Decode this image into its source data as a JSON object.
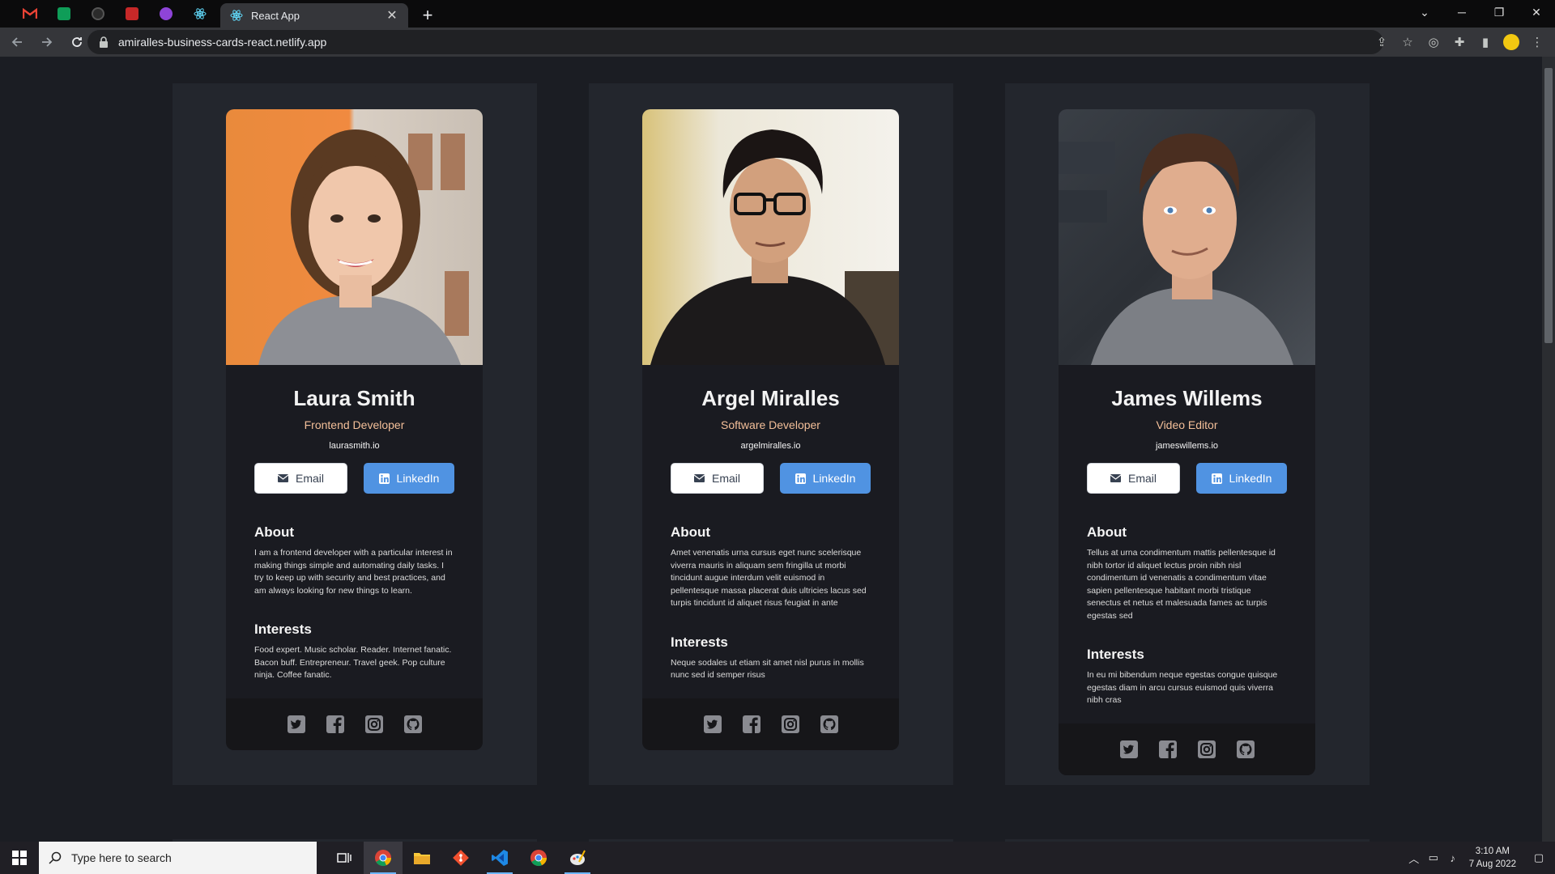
{
  "browser": {
    "active_tab_title": "React App",
    "tab_close": "✕",
    "new_tab": "+",
    "url": "amiralles-business-cards-react.netlify.app",
    "window_controls": {
      "menu": "⌄",
      "minimize": "─",
      "restore": "❐",
      "close": "✕"
    }
  },
  "cards": [
    {
      "name": "Laura Smith",
      "role": "Frontend Developer",
      "website": "laurasmith.io",
      "email_label": "Email",
      "linkedin_label": "LinkedIn",
      "about_title": "About",
      "about_text": "I am a frontend developer with a particular interest in making things simple and automating daily tasks. I try to keep up with security and best practices, and am always looking for new things to learn.",
      "interests_title": "Interests",
      "interests_text": "Food expert. Music scholar. Reader. Internet fanatic. Bacon buff. Entrepreneur. Travel geek. Pop culture ninja. Coffee fanatic."
    },
    {
      "name": "Argel Miralles",
      "role": "Software Developer",
      "website": "argelmiralles.io",
      "email_label": "Email",
      "linkedin_label": "LinkedIn",
      "about_title": "About",
      "about_text": "Amet venenatis urna cursus eget nunc scelerisque viverra mauris in aliquam sem fringilla ut morbi tincidunt augue interdum velit euismod in pellentesque massa placerat duis ultricies lacus sed turpis tincidunt id aliquet risus feugiat in ante",
      "interests_title": "Interests",
      "interests_text": "Neque sodales ut etiam sit amet nisl purus in mollis nunc sed id semper risus"
    },
    {
      "name": "James Willems",
      "role": "Video Editor",
      "website": "jameswillems.io",
      "email_label": "Email",
      "linkedin_label": "LinkedIn",
      "about_title": "About",
      "about_text": "Tellus at urna condimentum mattis pellentesque id nibh tortor id aliquet lectus proin nibh nisl condimentum id venenatis a condimentum vitae sapien pellentesque habitant morbi tristique senectus et netus et malesuada fames ac turpis egestas sed",
      "interests_title": "Interests",
      "interests_text": "In eu mi bibendum neque egestas congue quisque egestas diam in arcu cursus euismod quis viverra nibh cras"
    }
  ],
  "taskbar": {
    "search_placeholder": "Type here to search",
    "time": "3:10 AM",
    "date": "7 Aug 2022"
  }
}
